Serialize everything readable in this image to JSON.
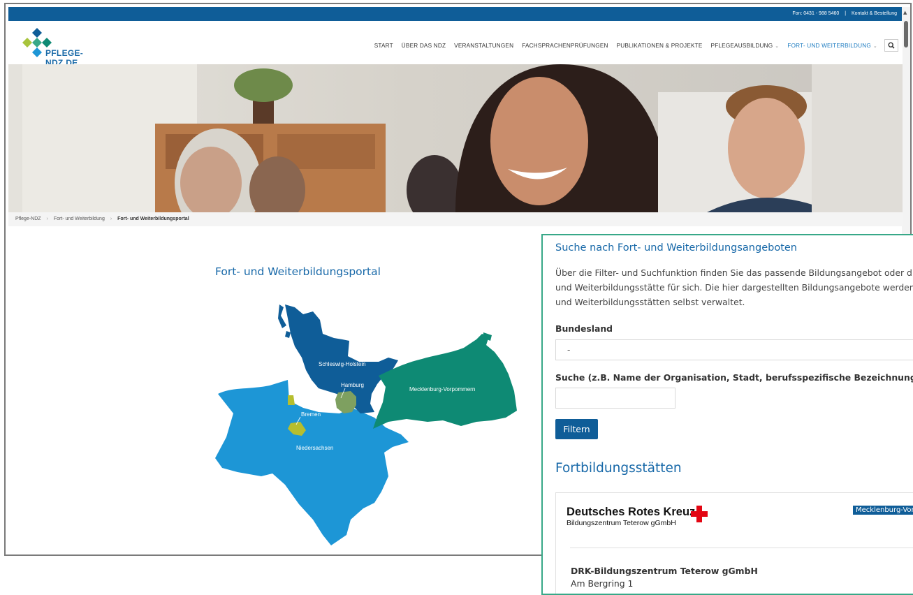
{
  "topbar": {
    "phone": "Fon: 0431 - 988 5460",
    "separator": "|",
    "contact": "Kontakt & Bestellung"
  },
  "logo": {
    "text": "PFLEGE-NDZ.DE"
  },
  "nav": {
    "items": [
      {
        "label": "START"
      },
      {
        "label": "ÜBER DAS NDZ"
      },
      {
        "label": "VERANSTALTUNGEN"
      },
      {
        "label": "FACHSPRACHENPRÜFUNGEN"
      },
      {
        "label": "PUBLIKATIONEN & PROJEKTE"
      },
      {
        "label": "PFLEGEAUSBILDUNG"
      },
      {
        "label": "FORT- UND WEITERBILDUNG"
      }
    ],
    "chevron": "⌄",
    "search_icon": "search-icon"
  },
  "breadcrumb": {
    "items": [
      "Pflege-NDZ",
      "Fort- und Weiterbildung",
      "Fort- und Weiterbildungsportal"
    ],
    "separator": "›"
  },
  "portal": {
    "title": "Fort- und Weiterbildungsportal"
  },
  "map": {
    "regions": [
      {
        "label": "Schleswig-Holstein",
        "color": "#0f5d98"
      },
      {
        "label": "Hamburg",
        "color": "#7ea060"
      },
      {
        "label": "Mecklenburg-Vorpommern",
        "color": "#0e8a74"
      },
      {
        "label": "Bremen",
        "color": "#b6be2e"
      },
      {
        "label": "Niedersachsen",
        "color": "#1d96d6"
      }
    ]
  },
  "panel": {
    "title": "Suche nach Fort- und Weiterbildungsangeboten",
    "description": [
      "Über die Filter- und Suchfunktion finden Sie das passende Bildungsangebot oder die pas",
      "und Weiterbildungsstätte für sich. Die hier dargestellten Bildungsangebote werden von",
      "und Weiterbildungsstätten selbst verwaltet."
    ],
    "bundesland_label": "Bundesland",
    "bundesland_value": "-",
    "search_label": "Suche (z.B. Name der Organisation, Stadt, berufsspezifische Bezeichnungen, etc.)",
    "search_value": "",
    "filter_button": "Filtern",
    "section_title": "Fortbildungsstätten",
    "card": {
      "logo_title": "Deutsches Rotes Kreuz",
      "logo_subtitle": "Bildungszentrum Teterow gGmbH",
      "badge": "Mecklenburg-Vorp",
      "org_name": "DRK-Bildungszentrum Teterow gGmbH",
      "street": "Am Bergring  1"
    }
  },
  "colors": {
    "brand_blue": "#0f5d98",
    "title_blue": "#1768a8",
    "panel_border": "#38a888",
    "red_cross": "#e30613"
  }
}
